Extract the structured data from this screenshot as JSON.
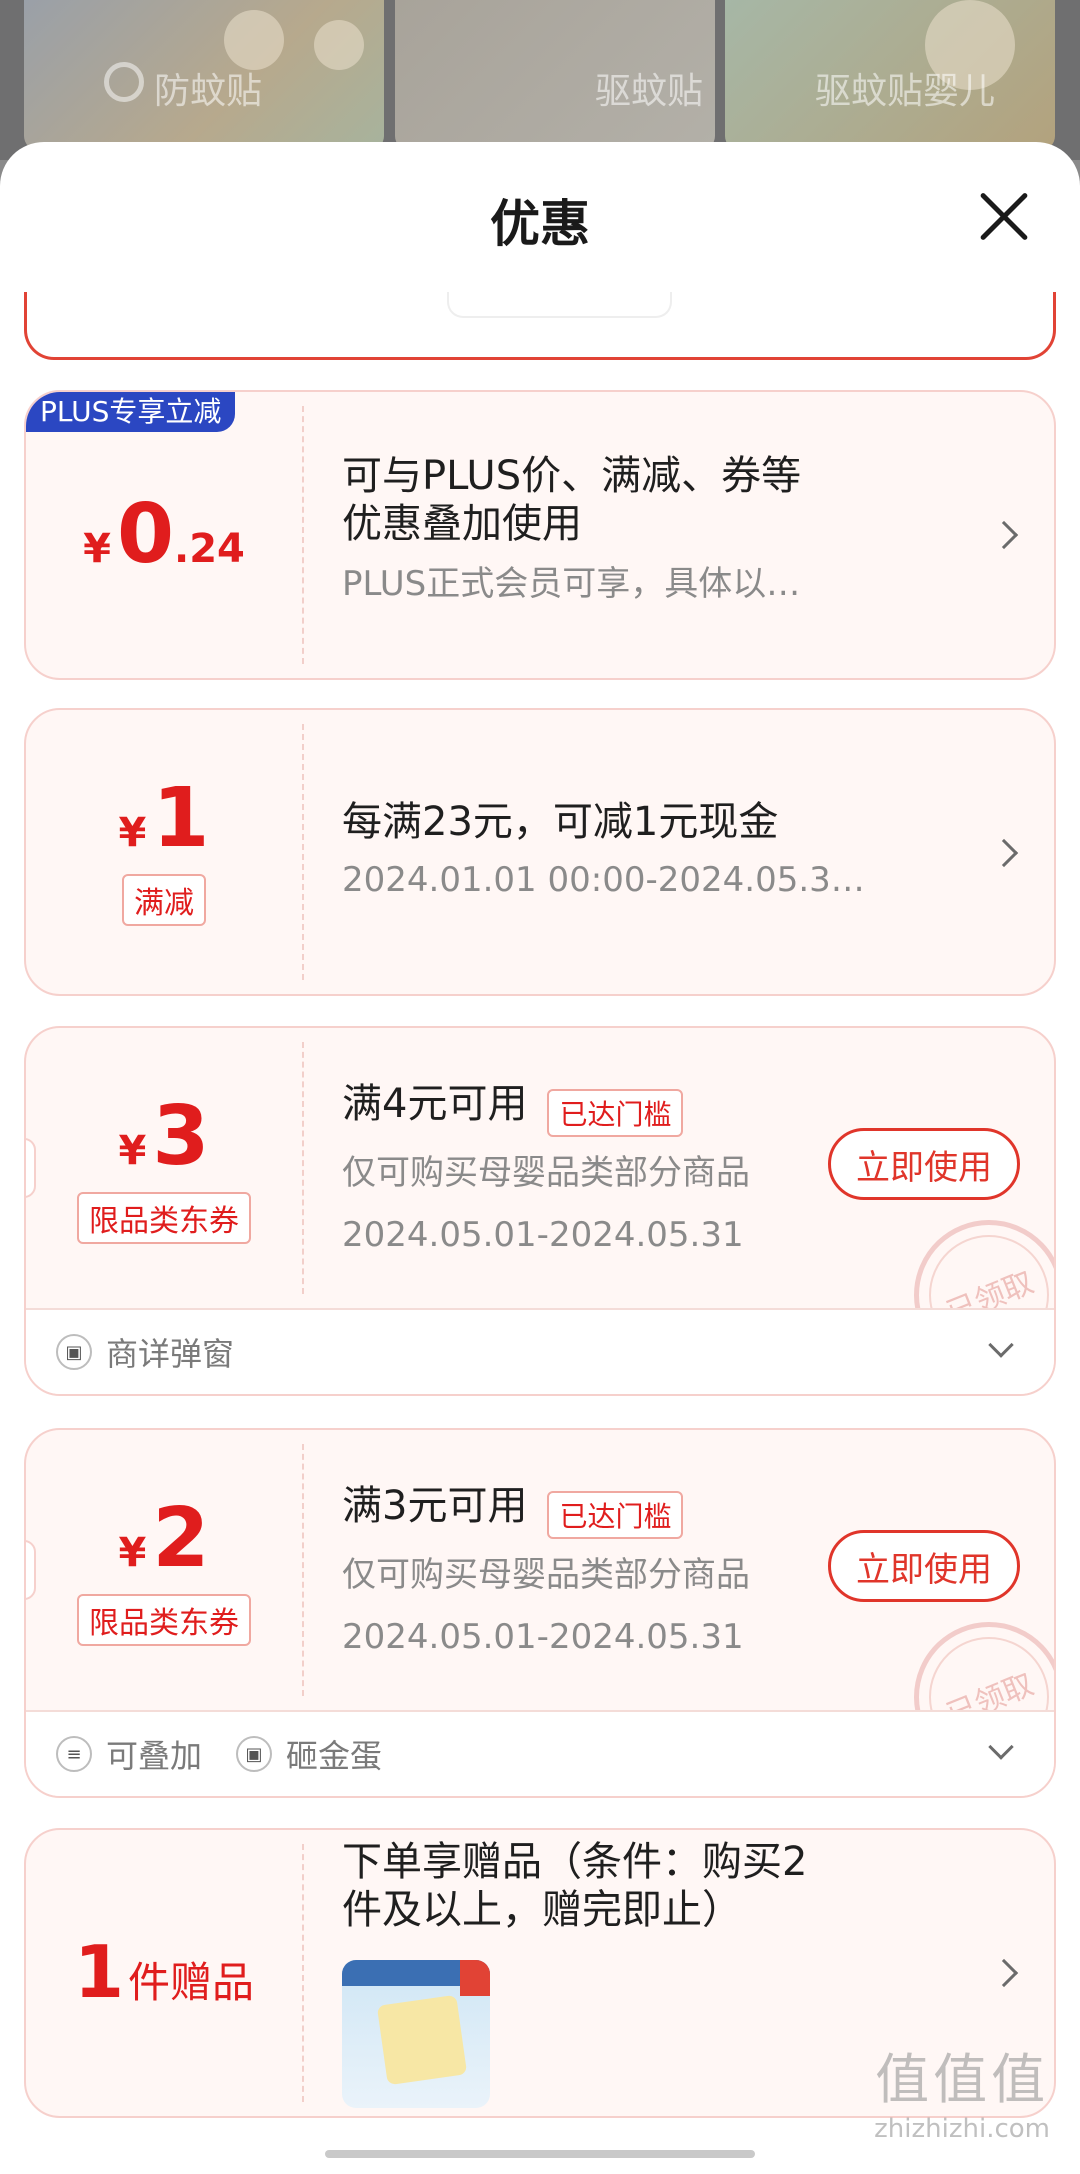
{
  "background": {
    "labels": [
      "防蚊贴",
      "驱蚊贴",
      "驱蚊贴婴儿"
    ]
  },
  "sheet": {
    "title": "优惠"
  },
  "coupons": [
    {
      "badge": "PLUS专享立减",
      "price_yen": "¥",
      "price_int": "0",
      "price_dec": ".24",
      "title_line1": "可与PLUS价、满减、券等",
      "title_line2": "优惠叠加使用",
      "subtitle": "PLUS正式会员可享，具体以…"
    },
    {
      "price_yen": "¥",
      "price_int": "1",
      "tag": "满减",
      "title": "每满23元，可减1元现金",
      "subtitle": "2024.01.01 00:00-2024.05.3…"
    },
    {
      "price_yen": "¥",
      "price_int": "3",
      "tag": "限品类东券",
      "title": "满4元可用",
      "reached": "已达门槛",
      "desc": "仅可购买母婴品类部分商品",
      "date": "2024.05.01-2024.05.31",
      "button": "立即使用",
      "stamp": "已领取",
      "footer": [
        "商详弹窗"
      ]
    },
    {
      "price_yen": "¥",
      "price_int": "2",
      "tag": "限品类东券",
      "title": "满3元可用",
      "reached": "已达门槛",
      "desc": "仅可购买母婴品类部分商品",
      "date": "2024.05.01-2024.05.31",
      "button": "立即使用",
      "stamp": "已领取",
      "footer": [
        "可叠加",
        "砸金蛋"
      ]
    },
    {
      "gift_count": "1",
      "gift_unit": "件赠品",
      "title_line1": "下单享赠品（条件：购买2",
      "title_line2": "件及以上，赠完即止）"
    }
  ],
  "watermark": {
    "big": "值值值",
    "small": "zhizhizhi.com"
  }
}
